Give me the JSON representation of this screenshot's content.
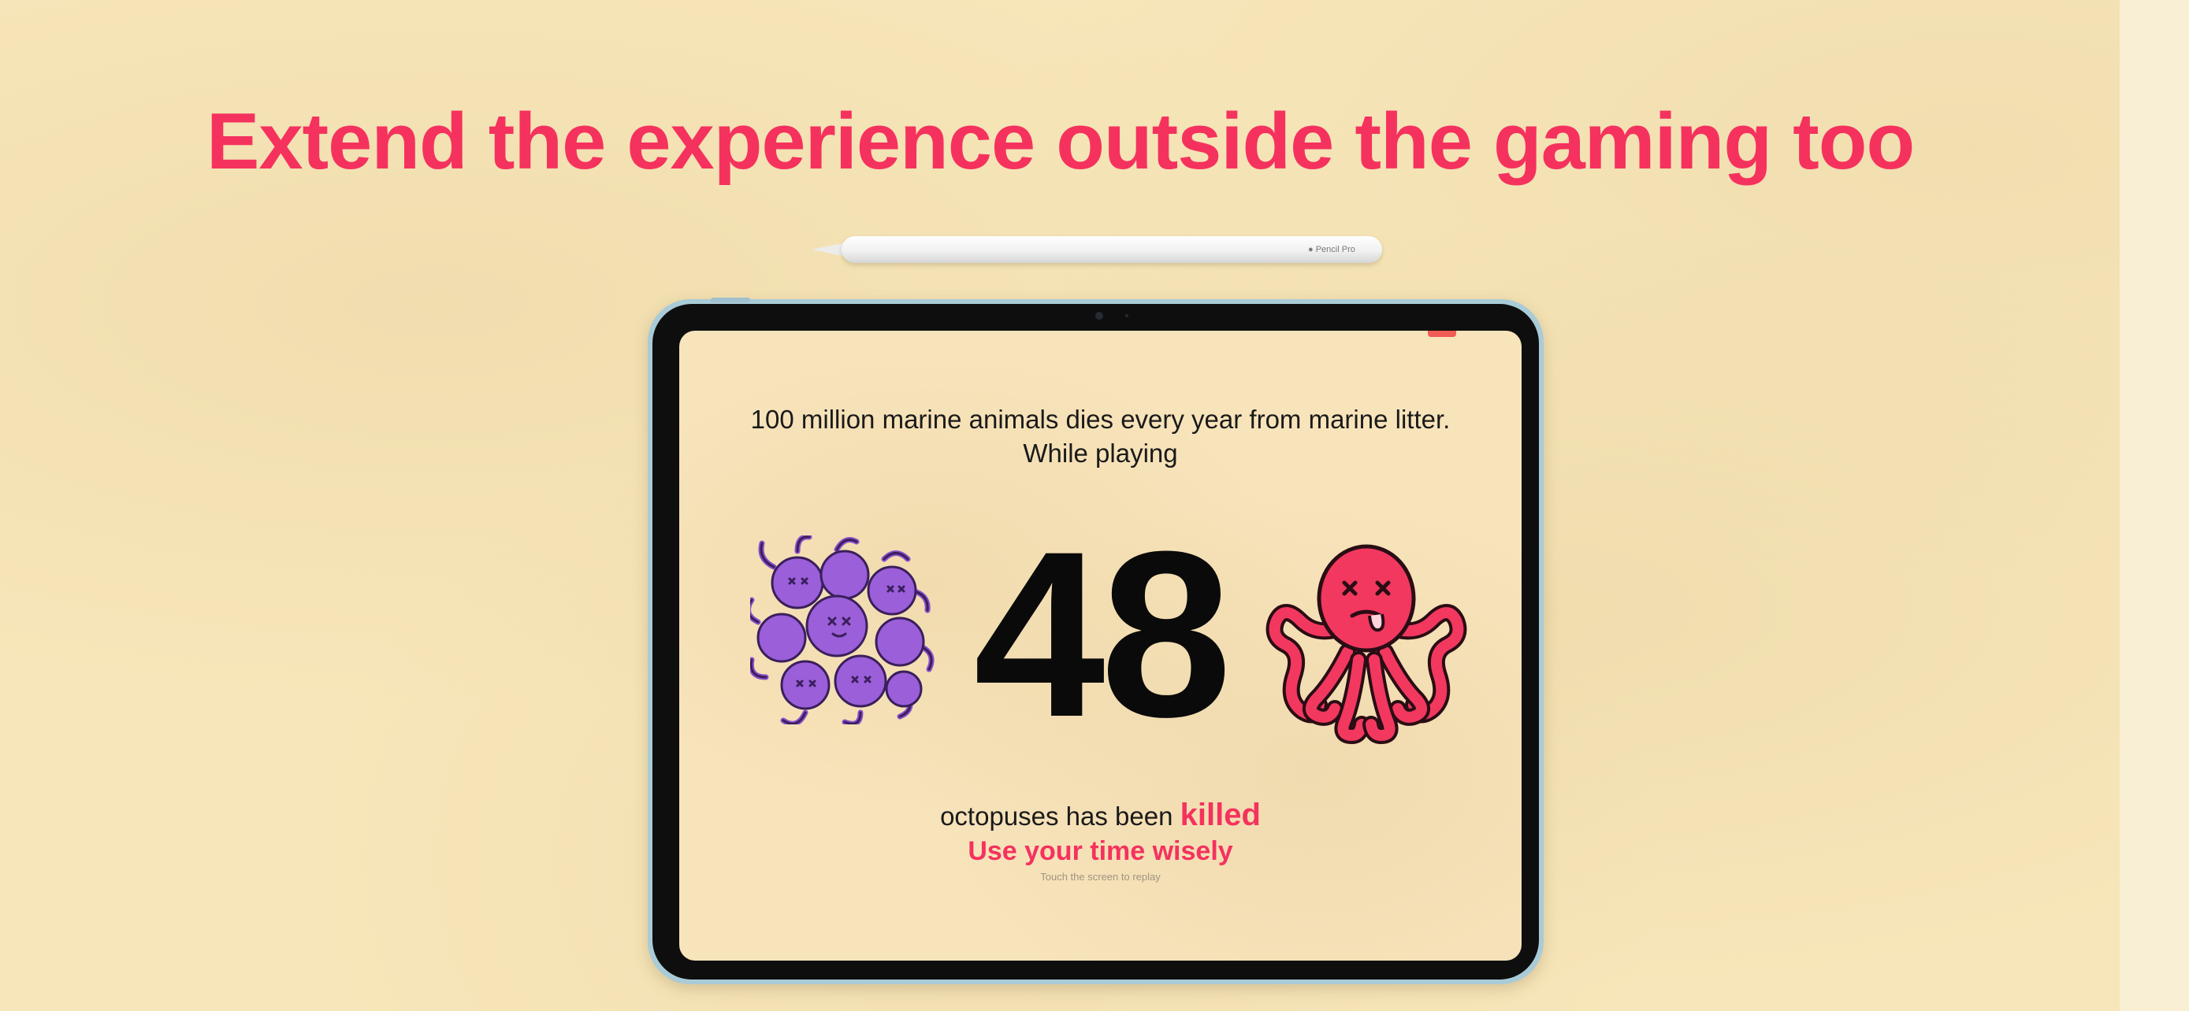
{
  "headline": "Extend the experience outside the gaming too",
  "pencil": {
    "label": "Pencil Pro",
    "icon": "apple-logo-icon"
  },
  "device": {
    "screen": {
      "intro_line_1": "100 million marine animals dies every year from marine litter.",
      "intro_line_2": "While playing",
      "count": "48",
      "killed_prefix": "octopuses has been ",
      "killed_word": "killed",
      "wisely": "Use your time wisely",
      "replay_hint": "Touch the screen to replay",
      "icons": [
        "octopus-pile-icon",
        "dead-octopus-icon"
      ]
    }
  },
  "colors": {
    "accent": "#f5325e",
    "background": "#f7e6b9",
    "octopus_purple": "#9b5fd9",
    "octopus_pink": "#f2385f",
    "ipad_frame": "#a9cbd7"
  }
}
